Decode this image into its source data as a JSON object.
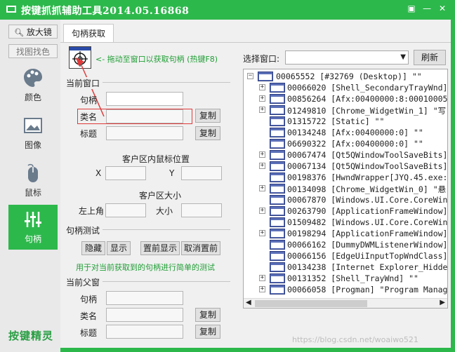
{
  "window": {
    "title": "按键抓抓辅助工具2014.05.16868",
    "controls": [
      "▣",
      "—",
      "✕"
    ]
  },
  "sidebar": {
    "magnifier_label": "放大镜",
    "find_image_label": "找图找色",
    "items": [
      {
        "label": "颜色",
        "icon": "palette-icon"
      },
      {
        "label": "图像",
        "icon": "image-icon"
      },
      {
        "label": "鼠标",
        "icon": "mouse-icon"
      },
      {
        "label": "句柄",
        "icon": "sliders-icon"
      }
    ],
    "brand": "按键精灵"
  },
  "tabs": [
    {
      "label": "句柄获取"
    }
  ],
  "handle": {
    "drag_hint": "<- 拖动至窗口以获取句柄 (热键F8)",
    "current_window": "当前窗口",
    "handle_label": "句柄",
    "class_label": "类名",
    "title_label": "标题",
    "copy_label": "复制",
    "mouse_pos_title": "客户区内鼠标位置",
    "x_label": "X",
    "y_label": "Y",
    "client_size_title": "客户区大小",
    "top_left_label": "左上角",
    "size_label": "大小",
    "test_title": "句柄测试",
    "hide_label": "隐藏",
    "show_label": "显示",
    "topmost_label": "置前显示",
    "cancel_topmost_label": "取消置前",
    "test_hint": "用于对当前获取到的句柄进行简单的测试",
    "parent_window": "当前父窗",
    "parent_handle_label": "句柄",
    "parent_class_label": "类名",
    "parent_title_label": "标题"
  },
  "select_window": {
    "label": "选择窗口:",
    "value": "",
    "refresh_label": "刷新"
  },
  "tree": {
    "root": "00065552 [#32769 (Desktop)] \"\"",
    "items": [
      "00066020 [Shell_SecondaryTrayWnd]",
      "00856264 [Afx:00400000:8:00010005",
      "01249810 [Chrome_WidgetWin_1] \"写",
      "01315722 [Static] \"\"",
      "00134248 [Afx:00400000:0] \"\"",
      "06690322 [Afx:00400000:0] \"\"",
      "00067474 [Qt5QWindowToolSaveBits]",
      "00067134 [Qt5QWindowToolSaveBits]",
      "00198376 [HwndWrapper[JYQ.45.exe:",
      "00134098 [Chrome_WidgetWin_0] \"悬",
      "00067870 [Windows.UI.Core.CoreWin",
      "00263790 [ApplicationFrameWindow]",
      "01509482 [Windows.UI.Core.CoreWin",
      "00198294 [ApplicationFrameWindow]",
      "00066162 [DummyDWMListenerWindow]",
      "00066156 [EdgeUiInputTopWndClass]",
      "00134238 [Internet Explorer_Hidde",
      "00131352 [Shell_TrayWnd] \"\"",
      "00066058 [Progman] \"Program Manag"
    ]
  },
  "watermark": "https://blog.csdn.net/woaiwo521",
  "colors": {
    "accent": "#2db84c",
    "hint_green": "#1f9e35",
    "highlight_red": "#e03a3a"
  }
}
